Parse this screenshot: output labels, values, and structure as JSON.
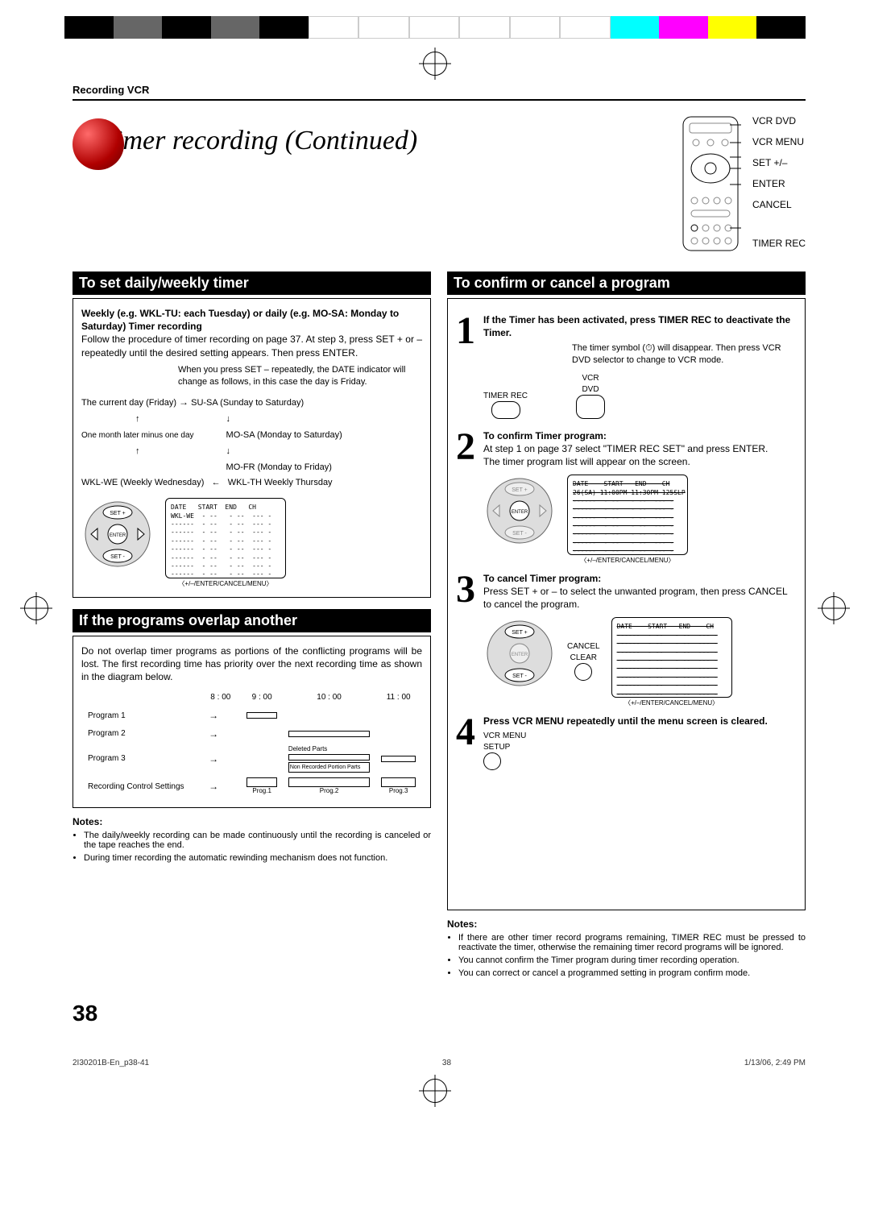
{
  "meta": {
    "section": "Recording VCR",
    "title": "Timer recording (Continued)",
    "page_number": "38",
    "footer_left": "2I30201B-En_p38-41",
    "footer_center": "38",
    "footer_right": "1/13/06, 2:49 PM"
  },
  "remote_labels": [
    "VCR DVD",
    "VCR MENU",
    "SET +/–",
    "ENTER",
    "CANCEL",
    "TIMER REC"
  ],
  "left": {
    "h1": "To set daily/weekly timer",
    "box1_bold": "Weekly (e.g. WKL-TU: each Tuesday) or daily (e.g. MO-SA: Monday to Saturday) Timer recording",
    "box1_p1": "Follow the procedure of timer recording on page 37. At step 3, press SET + or – repeatedly until the desired setting appears. Then press ENTER.",
    "box1_p2": "When you press SET – repeatedly, the DATE indicator will change as follows, in this case the day is Friday.",
    "flow": {
      "current": "The current day (Friday)",
      "su_sa": "SU-SA (Sunday to Saturday)",
      "one_month": "One month later minus one day",
      "mo_sa": "MO-SA (Monday to Saturday)",
      "mo_fr": "MO-FR (Monday to Friday)",
      "wkl_we": "WKL-WE (Weekly Wednesday)",
      "wkl_th": "WKL-TH Weekly Thursday"
    },
    "screen1_header": "DATE   START  END   CH",
    "screen1_row1": "WKL-WE  - --   - --  --- -",
    "screen1_dash": "------  - --   - --  --- -",
    "screen_caption": "〈+/–/ENTER/CANCEL/MENU〉",
    "h2": "If the programs overlap another",
    "box2_p": "Do not overlap timer programs as portions of the conflicting programs will be lost. The first recording time has priority over the next recording time as shown in the diagram below.",
    "overlap": {
      "times": [
        "8 : 00",
        "9 : 00",
        "10 : 00",
        "11 : 00"
      ],
      "rows": [
        "Program 1",
        "Program 2",
        "Program 3",
        "Recording Control Settings"
      ],
      "labels": {
        "deleted": "Deleted Parts",
        "nonrec": "Non Recorded Portion Parts",
        "p1": "Prog.1",
        "p2": "Prog.2",
        "p3": "Prog.3"
      }
    },
    "notes_title": "Notes:",
    "notes": [
      "The daily/weekly recording can be made continuously until the recording is canceled or the tape reaches the end.",
      "During timer recording the automatic rewinding mechanism does not function."
    ]
  },
  "right": {
    "h1": "To confirm or cancel a program",
    "step1_bold": "If the Timer has been activated, press TIMER REC to deactivate the Timer.",
    "step1_body": "The timer symbol (⏱) will disappear. Then press VCR DVD selector to change to VCR mode.",
    "step1_labels": {
      "timer_rec": "TIMER REC",
      "vcr_dvd": "VCR\nDVD"
    },
    "step2_bold": "To confirm Timer program:",
    "step2_body1": "At step 1 on page 37 select \"TIMER REC SET\" and press ENTER.",
    "step2_body2": "The timer program list will appear on the screen.",
    "screen2_header": "DATE    START   END    CH",
    "screen2_row1": "26(SA) 11:00PM 11:30PM 125SLP",
    "step3_bold": "To cancel Timer program:",
    "step3_body": "Press SET + or – to select the unwanted program, then press CANCEL to cancel the program.",
    "step3_labels": {
      "cancel": "CANCEL",
      "clear": "CLEAR"
    },
    "step4_bold": "Press VCR MENU repeatedly until the menu screen is cleared.",
    "step4_labels": {
      "vcr_menu": "VCR MENU",
      "setup": "SETUP"
    },
    "notes_title": "Notes:",
    "notes": [
      "If there are other timer record programs remaining, TIMER REC must be pressed to reactivate the timer, otherwise the remaining timer record programs will be ignored.",
      "You cannot confirm the Timer program during timer recording operation.",
      "You can correct or cancel a programmed setting in program confirm mode."
    ]
  }
}
